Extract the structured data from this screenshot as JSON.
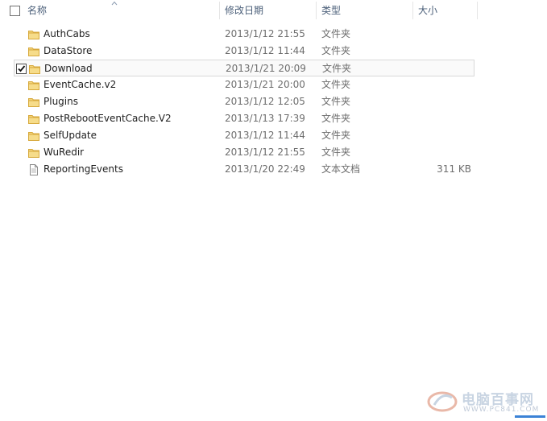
{
  "header": {
    "name": "名称",
    "date": "修改日期",
    "type": "类型",
    "size": "大小"
  },
  "rows": [
    {
      "name": "AuthCabs",
      "date": "2013/1/12 21:55",
      "type": "文件夹",
      "size": "",
      "icon": "folder-icon",
      "checked": false
    },
    {
      "name": "DataStore",
      "date": "2013/1/12 11:44",
      "type": "文件夹",
      "size": "",
      "icon": "folder-icon",
      "checked": false
    },
    {
      "name": "Download",
      "date": "2013/1/21 20:09",
      "type": "文件夹",
      "size": "",
      "icon": "folder-icon",
      "checked": true
    },
    {
      "name": "EventCache.v2",
      "date": "2013/1/21 20:00",
      "type": "文件夹",
      "size": "",
      "icon": "folder-icon",
      "checked": false
    },
    {
      "name": "Plugins",
      "date": "2013/1/12 12:05",
      "type": "文件夹",
      "size": "",
      "icon": "folder-icon",
      "checked": false
    },
    {
      "name": "PostRebootEventCache.V2",
      "date": "2013/1/13 17:39",
      "type": "文件夹",
      "size": "",
      "icon": "folder-icon",
      "checked": false
    },
    {
      "name": "SelfUpdate",
      "date": "2013/1/12 11:44",
      "type": "文件夹",
      "size": "",
      "icon": "folder-icon",
      "checked": false
    },
    {
      "name": "WuRedir",
      "date": "2013/1/12 21:55",
      "type": "文件夹",
      "size": "",
      "icon": "folder-icon",
      "checked": false
    },
    {
      "name": "ReportingEvents",
      "date": "2013/1/20 22:49",
      "type": "文本文档",
      "size": "311 KB",
      "icon": "text-file-icon",
      "checked": false
    }
  ],
  "watermark": {
    "text": "电脑百事网",
    "url": "WWW.PC841.COM"
  },
  "colors": {
    "header_text": "#4c607a",
    "folder": "#e9c25a",
    "selected_border": "#d9d9d9"
  }
}
